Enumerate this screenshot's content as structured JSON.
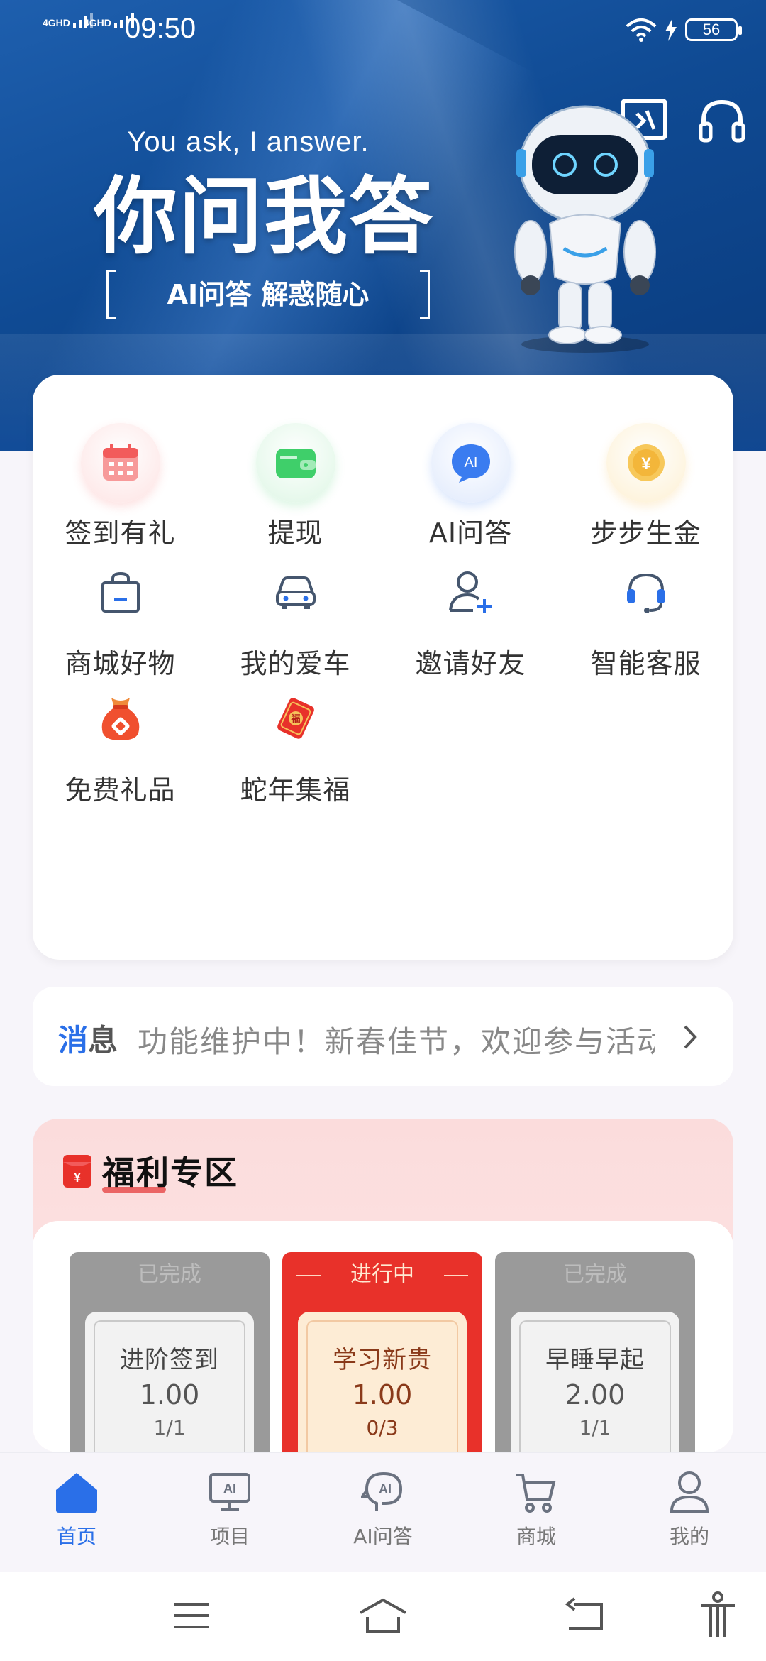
{
  "status_bar": {
    "network1": "4GHD",
    "network2": "4GHD",
    "time": "09:50",
    "battery": "56"
  },
  "hero": {
    "subtitle": "You ask, I answer.",
    "title": "你问我答",
    "tagline": "AI问答 解惑随心",
    "icons": [
      "scan-icon",
      "headphones-icon"
    ]
  },
  "grid": {
    "items": [
      {
        "label": "签到有礼",
        "icon": "calendar-icon",
        "color": "#f25b5b"
      },
      {
        "label": "提现",
        "icon": "wallet-icon",
        "color": "#3fcf6a"
      },
      {
        "label": "AI问答",
        "icon": "ai-chat-icon",
        "color": "#3a7cf0"
      },
      {
        "label": "步步生金",
        "icon": "coin-icon",
        "color": "#f3b63a"
      },
      {
        "label": "商城好物",
        "icon": "shopping-bag-icon",
        "color": "#45566e"
      },
      {
        "label": "我的爱车",
        "icon": "car-icon",
        "color": "#45566e"
      },
      {
        "label": "邀请好友",
        "icon": "invite-user-icon",
        "color": "#45566e"
      },
      {
        "label": "智能客服",
        "icon": "headset-icon",
        "color": "#45566e"
      },
      {
        "label": "免费礼品",
        "icon": "gift-bag-icon",
        "color": "#f0502f"
      },
      {
        "label": "蛇年集福",
        "icon": "fortune-card-icon",
        "color": "#e8312a"
      }
    ]
  },
  "notice": {
    "tag_a": "消",
    "tag_b": "息",
    "text": "功能维护中！新春佳节，欢迎参与活动"
  },
  "welfare": {
    "title": "福利专区",
    "tasks": [
      {
        "status": "已完成",
        "name": "进阶签到",
        "amount": "1.00",
        "progress": "1/1",
        "state": "done"
      },
      {
        "status": "进行中",
        "name": "学习新贵",
        "amount": "1.00",
        "progress": "0/3",
        "state": "active"
      },
      {
        "status": "已完成",
        "name": "早睡早起",
        "amount": "2.00",
        "progress": "1/1",
        "state": "done"
      }
    ]
  },
  "tabbar": {
    "tabs": [
      {
        "label": "首页",
        "icon": "home-icon",
        "active": true
      },
      {
        "label": "项目",
        "icon": "monitor-ai-icon",
        "active": false
      },
      {
        "label": "AI问答",
        "icon": "ai-head-icon",
        "active": false
      },
      {
        "label": "商城",
        "icon": "cart-icon",
        "active": false
      },
      {
        "label": "我的",
        "icon": "user-icon",
        "active": false
      }
    ],
    "accent": "#2a6fe8"
  },
  "system_nav": {
    "icons": [
      "menu-icon",
      "home-outline-icon",
      "back-icon",
      "accessibility-icon"
    ]
  }
}
